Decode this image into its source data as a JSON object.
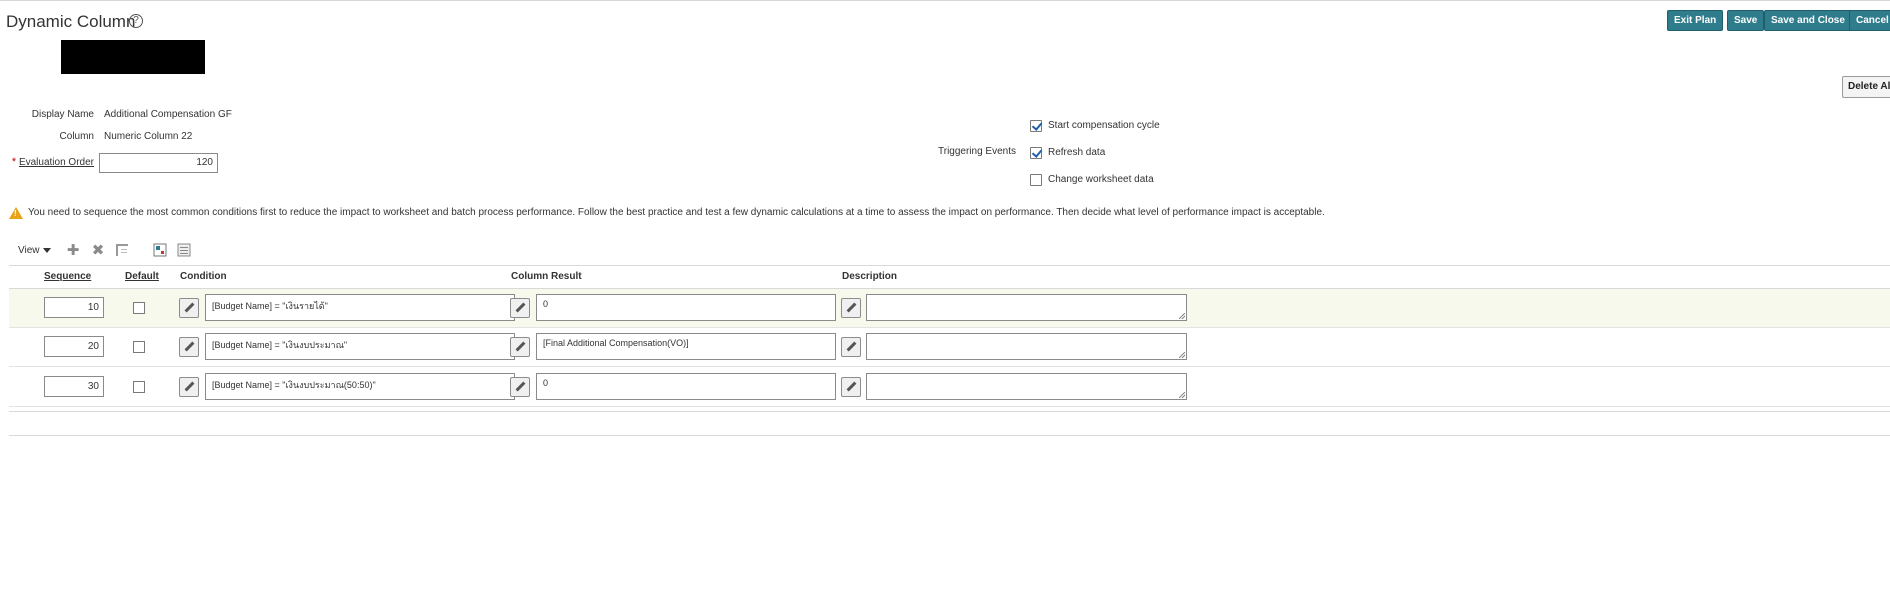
{
  "header": {
    "title": "Dynamic Column",
    "help_icon": "help-icon",
    "buttons": {
      "exit_plan": "Exit Plan",
      "save": "Save",
      "save_and_close": "Save and Close",
      "cancel": "Cancel",
      "delete_all": "Delete All"
    }
  },
  "form": {
    "display_name_label": "Display Name",
    "display_name_value": "Additional Compensation GF",
    "column_label": "Column",
    "column_value": "Numeric Column 22",
    "evaluation_order_label": "Evaluation Order",
    "evaluation_order_required": "*",
    "evaluation_order_value": "120",
    "triggering_events_label": "Triggering Events",
    "events": [
      {
        "label": "Start compensation cycle",
        "checked": true
      },
      {
        "label": "Refresh data",
        "checked": true
      },
      {
        "label": "Change worksheet data",
        "checked": false
      }
    ]
  },
  "warning": {
    "icon": "warning-icon",
    "text": "You need to sequence the most common conditions first to reduce the impact to worksheet and batch process performance. Follow the best practice and test a few dynamic calculations at a time to assess the impact on performance. Then decide what level of performance impact is acceptable."
  },
  "toolbar": {
    "view_label": "View",
    "icons": [
      "add-icon",
      "delete-icon",
      "freeze-icon",
      "export-icon",
      "detach-icon"
    ]
  },
  "table": {
    "columns": {
      "sequence": "Sequence",
      "default": "Default",
      "condition": "Condition",
      "result": "Column Result",
      "description": "Description"
    },
    "rows": [
      {
        "sequence": "10",
        "default": false,
        "condition": "[Budget Name]  =  \"เงินรายได้\"",
        "result": "0",
        "description": "",
        "selected": true
      },
      {
        "sequence": "20",
        "default": false,
        "condition": "[Budget Name]  =  \"เงินงบประมาณ\"",
        "result": "[Final Additional Compensation(VO)]",
        "description": "",
        "selected": false
      },
      {
        "sequence": "30",
        "default": false,
        "condition": "[Budget Name]  =  \"เงินงบประมาณ(50:50)\"",
        "result": "0",
        "description": "",
        "selected": false
      }
    ]
  }
}
